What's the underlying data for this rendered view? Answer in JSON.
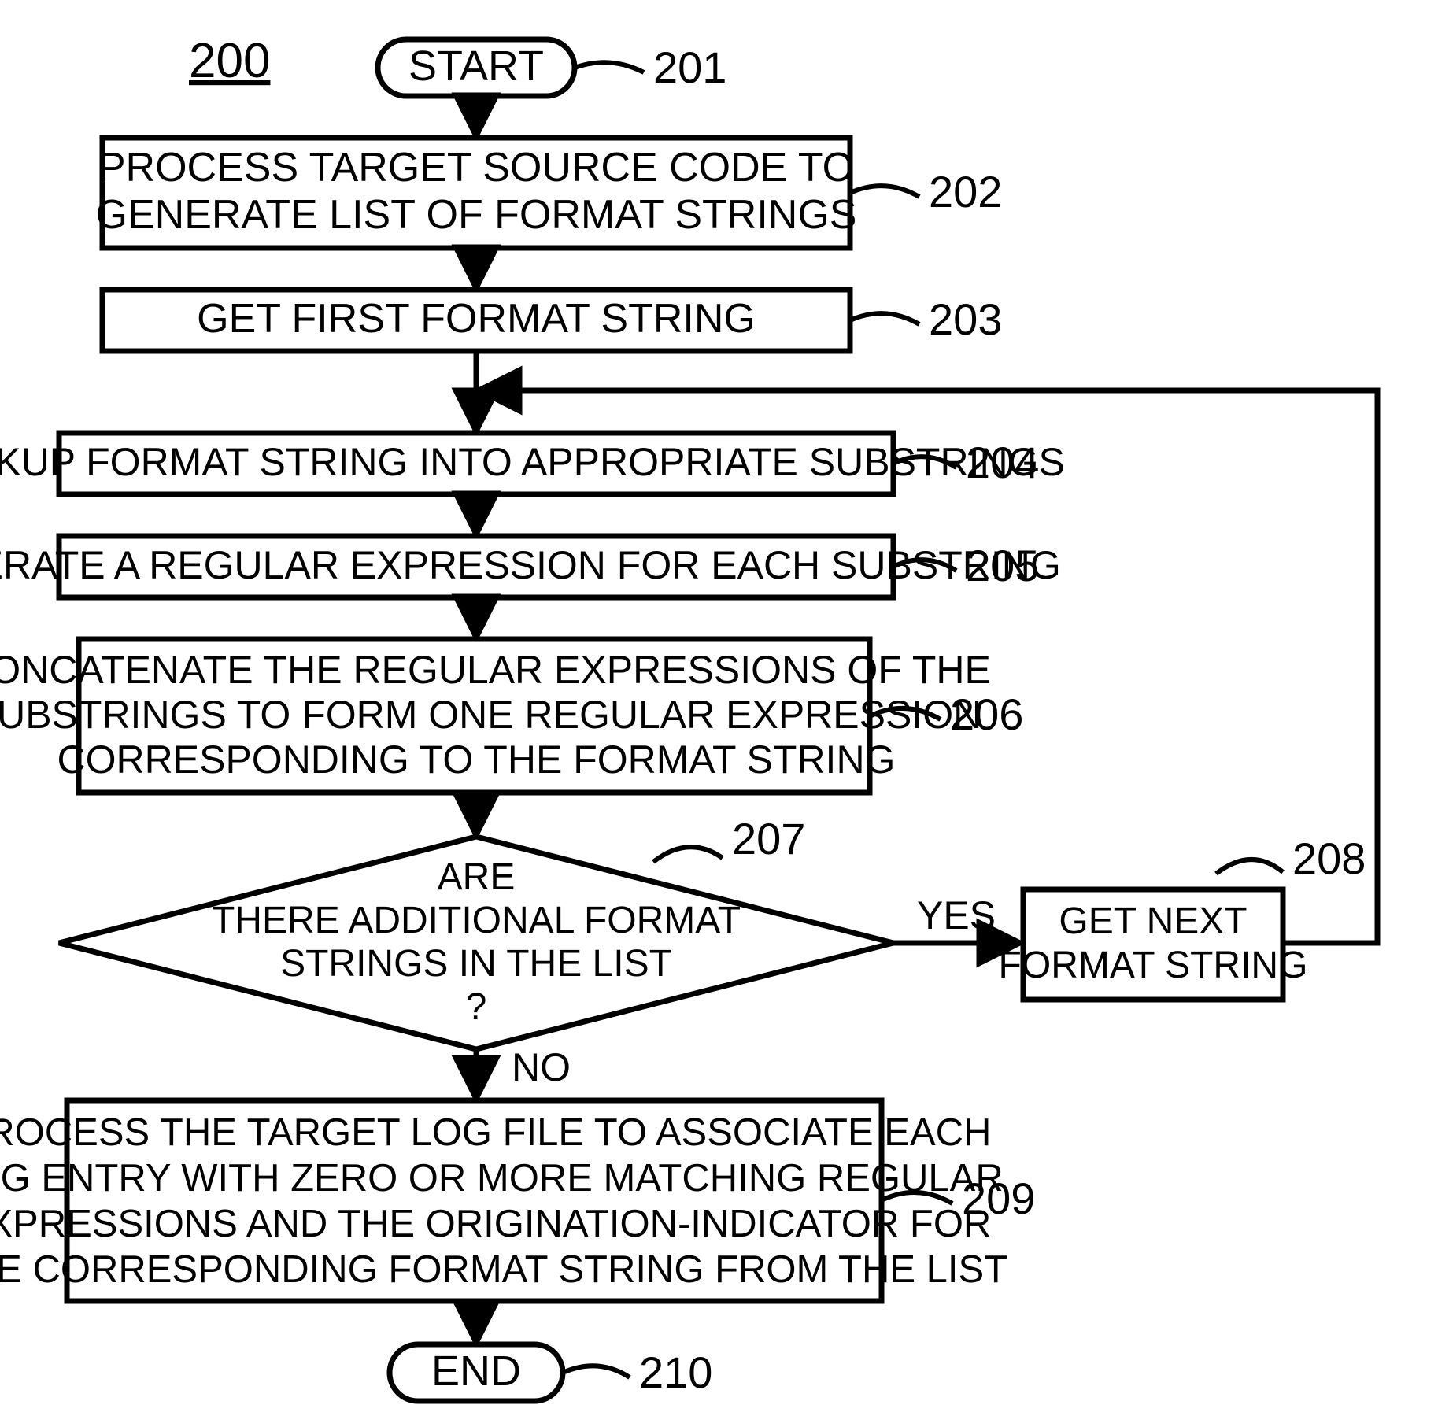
{
  "figure_number": "200",
  "nodes": {
    "start": {
      "label": "START",
      "ref": "201"
    },
    "step202": {
      "line1": "PROCESS TARGET SOURCE CODE TO",
      "line2": "GENERATE LIST OF FORMAT STRINGS",
      "ref": "202"
    },
    "step203": {
      "line1": "GET FIRST FORMAT STRING",
      "ref": "203"
    },
    "step204": {
      "line1": "BREAKUP FORMAT STRING INTO APPROPRIATE SUBSTRINGS",
      "ref": "204"
    },
    "step205": {
      "line1": "GENERATE A REGULAR EXPRESSION FOR EACH SUBSTRING",
      "ref": "205"
    },
    "step206": {
      "line1": "CONCATENATE THE REGULAR EXPRESSIONS OF THE",
      "line2": "SUBSTRINGS TO FORM ONE REGULAR EXPRESSION",
      "line3": "CORRESPONDING TO THE FORMAT STRING",
      "ref": "206"
    },
    "decision207": {
      "line1": "ARE",
      "line2": "THERE ADDITIONAL FORMAT",
      "line3": "STRINGS IN THE LIST",
      "line4": "?",
      "ref": "207",
      "yes": "YES",
      "no": "NO"
    },
    "step208": {
      "line1": "GET NEXT",
      "line2": "FORMAT STRING",
      "ref": "208"
    },
    "step209": {
      "line1": "PROCESS THE TARGET LOG FILE TO ASSOCIATE EACH",
      "line2": "LOG ENTRY WITH ZERO OR MORE MATCHING REGULAR",
      "line3": "EXPRESSIONS AND THE ORIGINATION-INDICATOR FOR",
      "line4": "THE CORRESPONDING FORMAT STRING FROM THE LIST",
      "ref": "209"
    },
    "end": {
      "label": "END",
      "ref": "210"
    }
  }
}
